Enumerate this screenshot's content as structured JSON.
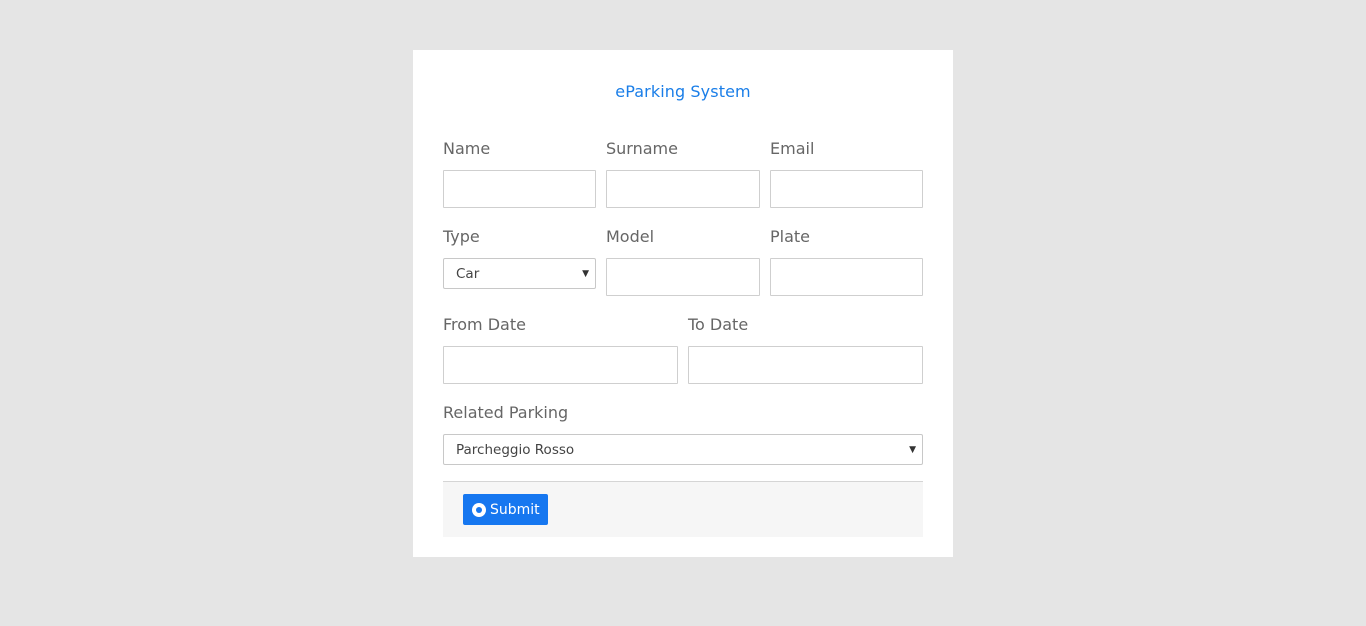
{
  "form": {
    "title": "eParking System",
    "labels": {
      "name": "Name",
      "surname": "Surname",
      "email": "Email",
      "type": "Type",
      "model": "Model",
      "plate": "Plate",
      "from_date": "From Date",
      "to_date": "To Date",
      "related_parking": "Related Parking"
    },
    "values": {
      "name": "",
      "surname": "",
      "email": "",
      "model": "",
      "plate": "",
      "from_date": "",
      "to_date": ""
    },
    "type_select": {
      "selected": "Car"
    },
    "parking_select": {
      "selected": "Parcheggio Rosso"
    },
    "submit_label": "Submit"
  },
  "colors": {
    "background": "#e5e5e5",
    "accent": "#1677f0",
    "title": "#1a7ee8",
    "label": "#666666"
  },
  "icons": {
    "submit": "circle-dot-icon",
    "select_caret": "caret-down-icon"
  }
}
